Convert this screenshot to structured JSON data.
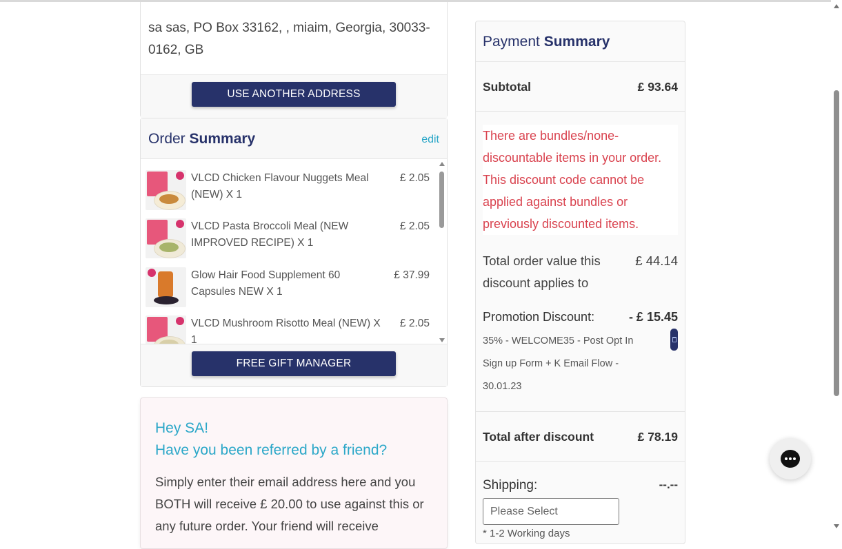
{
  "address": {
    "text": "sa sas, PO Box 33162, , miaim, Georgia, 30033-0162, GB",
    "use_another_label": "USE ANOTHER ADDRESS"
  },
  "order_summary": {
    "title_light": "Order",
    "title_bold": "Summary",
    "edit_label": "edit",
    "items": [
      {
        "name": "VLCD Chicken Flavour Nuggets Meal (NEW) X 1",
        "price": "£ 2.05"
      },
      {
        "name": "VLCD Pasta Broccoli Meal (NEW IMPROVED RECIPE) X 1",
        "price": "£ 2.05"
      },
      {
        "name": "Glow Hair Food Supplement 60 Capsules NEW X 1",
        "price": "£ 37.99"
      },
      {
        "name": "VLCD Mushroom Risotto Meal (NEW) X 1",
        "price": "£ 2.05"
      }
    ],
    "free_gift_label": "FREE GIFT MANAGER"
  },
  "referral": {
    "greeting": "Hey SA!",
    "question": "Have you been referred by a friend?",
    "body": "Simply enter their email address here and you BOTH will receive £ 20.00 to use against this or any future order. Your friend will receive"
  },
  "payment": {
    "title_light": "Payment",
    "title_bold": "Summary",
    "subtotal_label": "Subtotal",
    "subtotal_value": "£ 93.64",
    "warning": "There are bundles/none-discountable items in your order. This discount code cannot be applied against bundles or previously discounted items.",
    "order_value_label": "Total order value this discount applies to",
    "order_value_amount": "£ 44.14",
    "promo_label": "Promotion Discount:",
    "promo_amount": "- £ 15.45",
    "promo_code": "35% - WELCOME35 - Post Opt In Sign up Form + K Email Flow - 30.01.23",
    "total_after_label": "Total after discount",
    "total_after_value": "£ 78.19",
    "shipping_label": "Shipping:",
    "shipping_value": "--.--",
    "shipping_placeholder": "Please Select",
    "shipping_note": "* 1-2 Working days"
  },
  "colors": {
    "navy": "#27326a",
    "accent": "#2ba7c8",
    "warning": "#d9434f"
  }
}
